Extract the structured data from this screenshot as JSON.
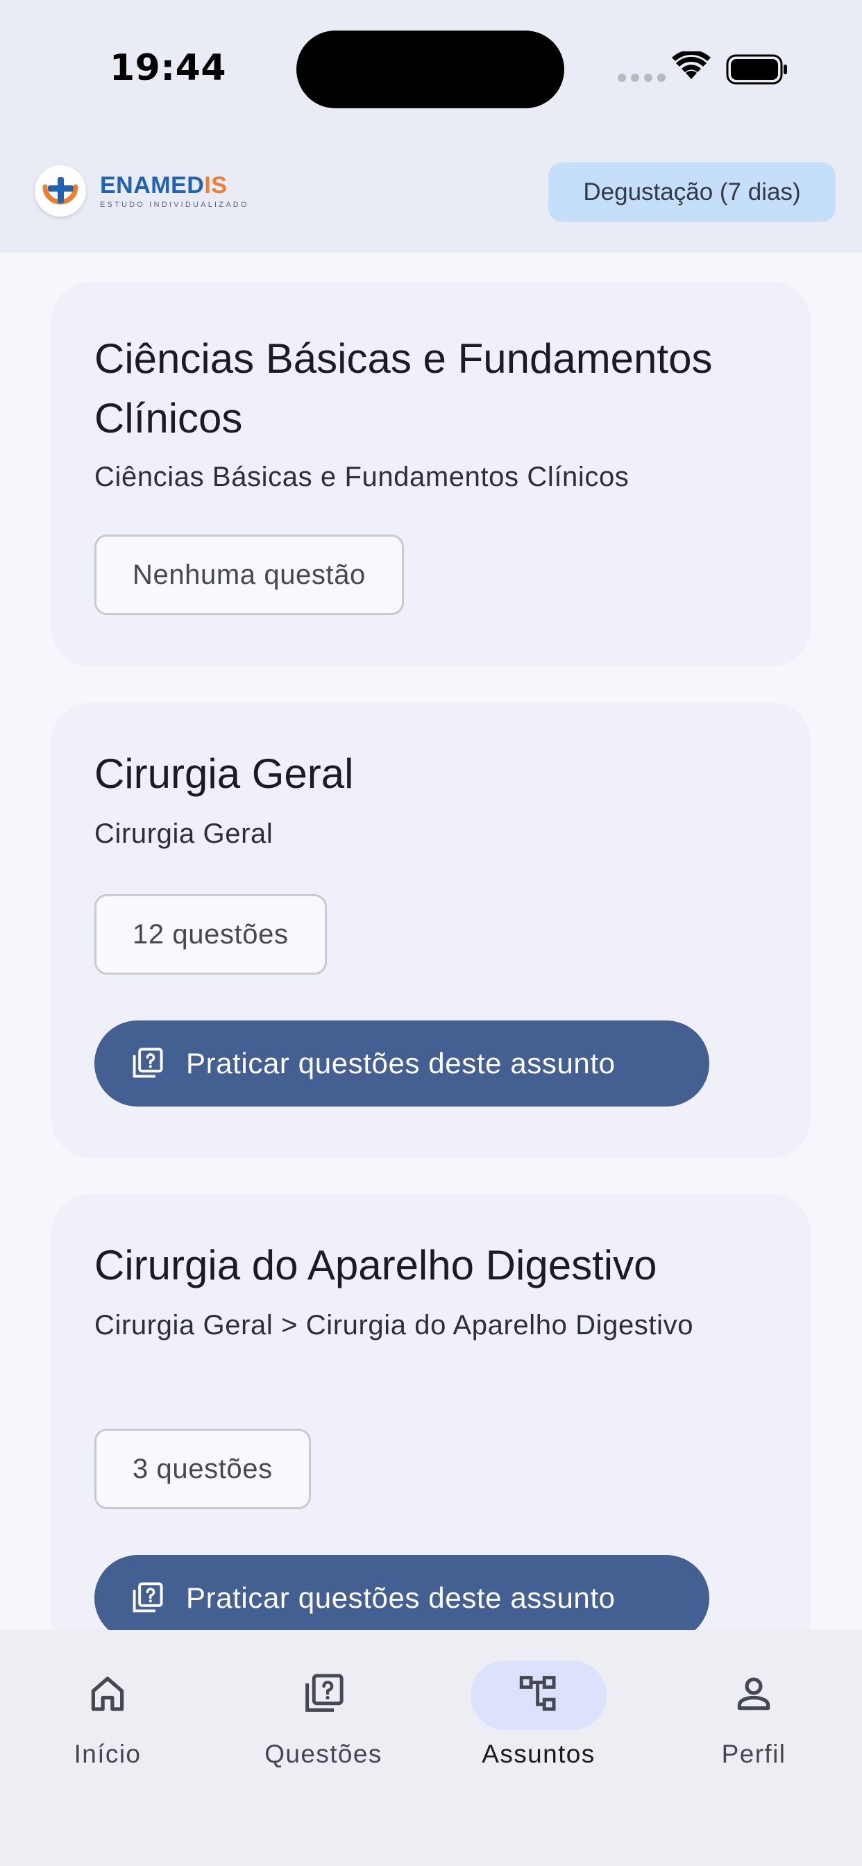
{
  "status_bar": {
    "time": "19:44"
  },
  "header": {
    "logo_word_primary": "ENAMED",
    "logo_word_accent": "IS",
    "logo_tagline": "ESTUDO INDIVIDUALIZADO",
    "trial_badge": "Degustação (7 dias)"
  },
  "subjects": [
    {
      "title": "Ciências Básicas e Fundamentos Clínicos",
      "path": "Ciências Básicas e Fundamentos Clínicos",
      "count_label": "Nenhuma questão"
    },
    {
      "title": "Cirurgia Geral",
      "path": "Cirurgia Geral",
      "count_label": "12 questões",
      "practice_label": "Praticar questões deste assunto"
    },
    {
      "title": "Cirurgia do Aparelho Digestivo",
      "path": "Cirurgia Geral > Cirurgia do Aparelho Digestivo",
      "count_label": "3 questões",
      "practice_label": "Praticar questões deste assunto"
    }
  ],
  "bottom_nav": {
    "items": [
      {
        "label": "Início",
        "icon": "home-icon"
      },
      {
        "label": "Questões",
        "icon": "quiz-icon"
      },
      {
        "label": "Assuntos",
        "icon": "topics-tree-icon",
        "active": true
      },
      {
        "label": "Perfil",
        "icon": "person-icon"
      }
    ]
  },
  "colors": {
    "primary_button": "#445f91",
    "trial_badge_bg": "#c5defa",
    "active_nav_pill": "#dce2fb",
    "logo_blue": "#1d63b8",
    "logo_orange": "#f07d2a"
  }
}
